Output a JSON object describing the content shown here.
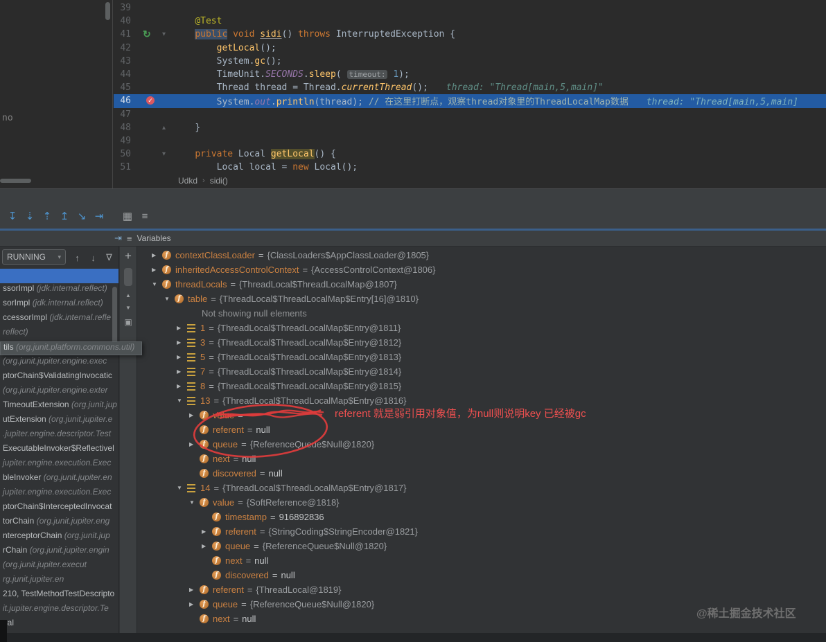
{
  "colors": {
    "debug_line": "#235ba3",
    "selection_blue": "#3a6fc2",
    "annotation_red": "#e03c3c",
    "field_icon_orange": "#c87f3a",
    "editor_bg": "#2b2b2b",
    "panel_bg": "#313335"
  },
  "editor": {
    "stub_text": "no",
    "breadcrumb": [
      "Udkd",
      "sidi()"
    ],
    "lines": [
      {
        "num": "39",
        "tokens": []
      },
      {
        "num": "40",
        "tokens": [
          [
            "    ",
            ""
          ],
          [
            "@Test",
            "a"
          ]
        ]
      },
      {
        "num": "41",
        "gutter": "run",
        "fold": "v",
        "tokens": [
          [
            "    ",
            ""
          ],
          [
            "public",
            "k sel"
          ],
          [
            " ",
            ""
          ],
          [
            "void",
            "k"
          ],
          [
            " ",
            ""
          ],
          [
            "sidi",
            "m u"
          ],
          [
            "() ",
            ""
          ],
          [
            "throws",
            "k"
          ],
          [
            " InterruptedException {",
            ""
          ]
        ]
      },
      {
        "num": "42",
        "tokens": [
          [
            "        ",
            ""
          ],
          [
            "getLocal",
            "m"
          ],
          [
            "();",
            ""
          ]
        ]
      },
      {
        "num": "43",
        "tokens": [
          [
            "        ",
            ""
          ],
          [
            "System.",
            ""
          ],
          [
            "gc",
            "m"
          ],
          [
            "();",
            ""
          ]
        ]
      },
      {
        "num": "44",
        "tokens": [
          [
            "        ",
            ""
          ],
          [
            "TimeUnit.",
            ""
          ],
          [
            "SECONDS",
            "sf"
          ],
          [
            ".",
            ""
          ],
          [
            "sleep",
            "m"
          ],
          [
            "( ",
            ""
          ],
          [
            "timeout:",
            "chip"
          ],
          [
            " ",
            ""
          ],
          [
            "1",
            "n"
          ],
          [
            ");",
            ""
          ]
        ]
      },
      {
        "num": "45",
        "tokens": [
          [
            "        ",
            ""
          ],
          [
            "Thread thread = Thread.",
            ""
          ],
          [
            "currentThread",
            "mi"
          ],
          [
            "();",
            ""
          ]
        ],
        "hint": "thread: \"Thread[main,5,main]\""
      },
      {
        "num": "46",
        "bp": true,
        "cur": true,
        "tokens": [
          [
            "        ",
            ""
          ],
          [
            "System.",
            ""
          ],
          [
            "out",
            "sf"
          ],
          [
            ".",
            ""
          ],
          [
            "println",
            "m"
          ],
          [
            "(thread); ",
            ""
          ],
          [
            "// 在这里打断点，观察thread对象里的ThreadLocalMap数据",
            "c"
          ]
        ],
        "hint": "thread: \"Thread[main,5,main]"
      },
      {
        "num": "47",
        "tokens": []
      },
      {
        "num": "48",
        "fold": "^",
        "tokens": [
          [
            "    ",
            ""
          ],
          [
            "}",
            ""
          ]
        ]
      },
      {
        "num": "49",
        "tokens": []
      },
      {
        "num": "50",
        "fold": "v",
        "tokens": [
          [
            "    ",
            ""
          ],
          [
            "private",
            "k"
          ],
          [
            " Local ",
            ""
          ],
          [
            "getLocal",
            "m hl"
          ],
          [
            "() {",
            ""
          ]
        ]
      },
      {
        "num": "51",
        "tokens": [
          [
            "        ",
            ""
          ],
          [
            "Local local = ",
            ""
          ],
          [
            "new",
            "k"
          ],
          [
            " ",
            ""
          ],
          [
            "Local();",
            ""
          ]
        ]
      }
    ]
  },
  "debug_toolbar": {
    "icons": [
      {
        "name": "show-execution-point-icon",
        "glyph": "↧",
        "tone": "blue"
      },
      {
        "name": "step-over-icon",
        "glyph": "⇣",
        "tone": "blue"
      },
      {
        "name": "step-into-icon",
        "glyph": "⇡",
        "tone": "blue"
      },
      {
        "name": "force-step-into-icon",
        "glyph": "↥",
        "tone": "blue"
      },
      {
        "name": "step-out-icon",
        "glyph": "↘",
        "tone": "blue"
      },
      {
        "name": "run-to-cursor-icon",
        "glyph": "⇥",
        "tone": "blue"
      },
      {
        "name": "layout-grid-icon",
        "glyph": "▦",
        "tone": "gray",
        "gap": true
      },
      {
        "name": "settings-icon",
        "glyph": "≡",
        "tone": "gray"
      }
    ]
  },
  "tabs": {
    "rewind_icon": "⇥",
    "menu_icon": "≡",
    "variables_label": "Variables"
  },
  "frames": {
    "thread_dropdown": "RUNNING",
    "dropdown_caret": "▾",
    "header_icons": [
      {
        "name": "navigate-up-icon",
        "glyph": "↑"
      },
      {
        "name": "navigate-down-icon",
        "glyph": "↓"
      },
      {
        "name": "filter-icon",
        "glyph": "∇"
      }
    ],
    "strip_icons": [
      {
        "name": "add-watch-icon",
        "glyph": "+",
        "cls": "plus"
      },
      {
        "name": "scroll-up-icon",
        "glyph": "▲",
        "cls": "tri"
      },
      {
        "name": "scroll-down-icon",
        "glyph": "▼",
        "cls": "tri"
      },
      {
        "name": "copy-stack-icon",
        "glyph": "▣",
        "cls": "sq"
      }
    ],
    "rows": [
      {
        "sel": true,
        "name": "",
        "pkg": ""
      },
      {
        "name": "ssorImpl ",
        "pkg": "(jdk.internal.reflect)"
      },
      {
        "name": "sorImpl ",
        "pkg": "(jdk.internal.reflect)"
      },
      {
        "name": "ccessorImpl ",
        "pkg": "(jdk.internal.refle"
      },
      {
        "name": "",
        "pkg": "reflect)"
      },
      {
        "tip": true,
        "name": "tils ",
        "pkg": "(org.junit.platform.commons.util)"
      },
      {
        "name": "",
        "pkg": "(org.junit.jupiter.engine.exec"
      },
      {
        "name": "ptorChain$ValidatingInvocatic",
        "pkg": ""
      },
      {
        "name": "",
        "pkg": "(org.junit.jupiter.engine.exter"
      },
      {
        "name": "TimeoutExtension ",
        "pkg": "(org.junit.jup"
      },
      {
        "name": "utExtension ",
        "pkg": "(org.junit.jupiter.e"
      },
      {
        "name": "",
        "pkg": ".jupiter.engine.descriptor.Test"
      },
      {
        "name": "ExecutableInvoker$Reflectivel",
        "pkg": ""
      },
      {
        "name": "",
        "pkg": "jupiter.engine.execution.Exec"
      },
      {
        "name": "bleInvoker ",
        "pkg": "(org.junit.jupiter.en"
      },
      {
        "name": "",
        "pkg": "jupiter.engine.execution.Exec"
      },
      {
        "name": "ptorChain$InterceptedInvocat",
        "pkg": ""
      },
      {
        "name": "torChain ",
        "pkg": "(org.junit.jupiter.eng"
      },
      {
        "name": "nterceptorChain ",
        "pkg": "(org.junit.jup"
      },
      {
        "name": "rChain ",
        "pkg": "(org.junit.jupiter.engin"
      },
      {
        "name": "",
        "pkg": "(org.junit.jupiter.execut"
      },
      {
        "name": "",
        "pkg": "rg.junit.jupiter.en"
      },
      {
        "name": "210, TestMethodTestDescripto",
        "pkg": ""
      },
      {
        "name": "",
        "pkg": "it.jupiter.engine.descriptor.Te"
      },
      {
        "name": "nal",
        "pkg": ""
      }
    ]
  },
  "variables": {
    "rows": [
      {
        "lvl": 0,
        "exp": "c",
        "icon": "f",
        "name": "contextClassLoader",
        "value": "{ClassLoaders$AppClassLoader@1805}",
        "vt": "ref"
      },
      {
        "lvl": 0,
        "exp": "c",
        "icon": "f",
        "name": "inheritedAccessControlContext",
        "value": "{AccessControlContext@1806}",
        "vt": "ref"
      },
      {
        "lvl": 0,
        "exp": "o",
        "icon": "f",
        "name": "threadLocals",
        "value": "{ThreadLocal$ThreadLocalMap@1807}",
        "vt": "ref"
      },
      {
        "lvl": 1,
        "exp": "o",
        "icon": "f",
        "name": "table",
        "value": "{ThreadLocal$ThreadLocalMap$Entry[16]@1810}",
        "vt": "ref"
      },
      {
        "lvl": 2,
        "info": "Not showing null elements"
      },
      {
        "lvl": 2,
        "exp": "c",
        "icon": "a",
        "name": "1",
        "value": "{ThreadLocal$ThreadLocalMap$Entry@1811}",
        "vt": "ref"
      },
      {
        "lvl": 2,
        "exp": "c",
        "icon": "a",
        "name": "3",
        "value": "{ThreadLocal$ThreadLocalMap$Entry@1812}",
        "vt": "ref"
      },
      {
        "lvl": 2,
        "exp": "c",
        "icon": "a",
        "name": "5",
        "value": "{ThreadLocal$ThreadLocalMap$Entry@1813}",
        "vt": "ref"
      },
      {
        "lvl": 2,
        "exp": "c",
        "icon": "a",
        "name": "7",
        "value": "{ThreadLocal$ThreadLocalMap$Entry@1814}",
        "vt": "ref"
      },
      {
        "lvl": 2,
        "exp": "c",
        "icon": "a",
        "name": "8",
        "value": "{ThreadLocal$ThreadLocalMap$Entry@1815}",
        "vt": "ref"
      },
      {
        "lvl": 2,
        "exp": "o",
        "icon": "a",
        "name": "13",
        "value": "{ThreadLocal$ThreadLocalMap$Entry@1816}",
        "vt": "ref"
      },
      {
        "lvl": 3,
        "exp": "c",
        "icon": "f",
        "name": "value",
        "value": "",
        "vt": "ref",
        "scribbled": true
      },
      {
        "lvl": 3,
        "exp": "",
        "icon": "f",
        "name": "referent",
        "value": "null",
        "vt": "null"
      },
      {
        "lvl": 3,
        "exp": "c",
        "icon": "f",
        "name": "queue",
        "value": "{ReferenceQueue$Null@1820}",
        "vt": "ref"
      },
      {
        "lvl": 3,
        "exp": "",
        "icon": "f",
        "name": "next",
        "value": "null",
        "vt": "null"
      },
      {
        "lvl": 3,
        "exp": "",
        "icon": "f",
        "name": "discovered",
        "value": "null",
        "vt": "null"
      },
      {
        "lvl": 2,
        "exp": "o",
        "icon": "a",
        "name": "14",
        "value": "{ThreadLocal$ThreadLocalMap$Entry@1817}",
        "vt": "ref"
      },
      {
        "lvl": 3,
        "exp": "o",
        "icon": "f",
        "name": "value",
        "value": "{SoftReference@1818}",
        "vt": "ref"
      },
      {
        "lvl": 4,
        "exp": "",
        "icon": "f",
        "name": "timestamp",
        "value": "916892836",
        "vt": "num"
      },
      {
        "lvl": 4,
        "exp": "c",
        "icon": "f",
        "name": "referent",
        "value": "{StringCoding$StringEncoder@1821}",
        "vt": "ref"
      },
      {
        "lvl": 4,
        "exp": "c",
        "icon": "f",
        "name": "queue",
        "value": "{ReferenceQueue$Null@1820}",
        "vt": "ref"
      },
      {
        "lvl": 4,
        "exp": "",
        "icon": "f",
        "name": "next",
        "value": "null",
        "vt": "null"
      },
      {
        "lvl": 4,
        "exp": "",
        "icon": "f",
        "name": "discovered",
        "value": "null",
        "vt": "null"
      },
      {
        "lvl": 3,
        "exp": "c",
        "icon": "f",
        "name": "referent",
        "value": "{ThreadLocal@1819}",
        "vt": "ref"
      },
      {
        "lvl": 3,
        "exp": "c",
        "icon": "f",
        "name": "queue",
        "value": "{ReferenceQueue$Null@1820}",
        "vt": "ref"
      },
      {
        "lvl": 3,
        "exp": "",
        "icon": "f",
        "name": "next",
        "value": "null",
        "vt": "null"
      }
    ]
  },
  "annotations": {
    "note_text": "referent 就是弱引用对象值，为null则说明key 已经被gc",
    "watermark": "@稀土掘金技术社区",
    "footer_text": "nal"
  }
}
